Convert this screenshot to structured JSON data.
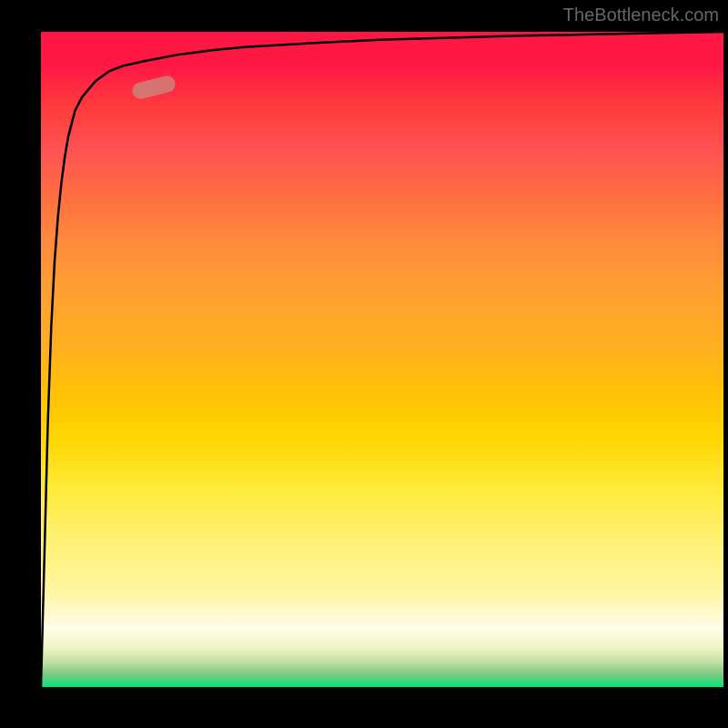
{
  "watermark": "TheBottleneck.com",
  "chart_data": {
    "type": "line",
    "title": "",
    "xlabel": "",
    "ylabel": "",
    "x": [
      0.0,
      0.005,
      0.01,
      0.015,
      0.02,
      0.025,
      0.03,
      0.035,
      0.04,
      0.05,
      0.06,
      0.08,
      0.1,
      0.12,
      0.15,
      0.2,
      0.25,
      0.3,
      0.4,
      0.5,
      0.6,
      0.7,
      0.8,
      0.9,
      1.0
    ],
    "values": [
      0.0,
      0.2,
      0.4,
      0.55,
      0.65,
      0.72,
      0.77,
      0.81,
      0.84,
      0.88,
      0.9,
      0.925,
      0.94,
      0.948,
      0.955,
      0.965,
      0.972,
      0.977,
      0.983,
      0.988,
      0.991,
      0.994,
      0.996,
      0.998,
      1.0
    ],
    "xlim": [
      0,
      1
    ],
    "ylim": [
      0,
      1
    ],
    "marker_position": {
      "x": 0.165,
      "y": 0.915
    },
    "background_gradient": {
      "type": "vertical",
      "stops": [
        {
          "position": 0.0,
          "color": "#ff1744"
        },
        {
          "position": 0.5,
          "color": "#ffc107"
        },
        {
          "position": 0.8,
          "color": "#fff176"
        },
        {
          "position": 1.0,
          "color": "#00e676"
        }
      ]
    }
  }
}
